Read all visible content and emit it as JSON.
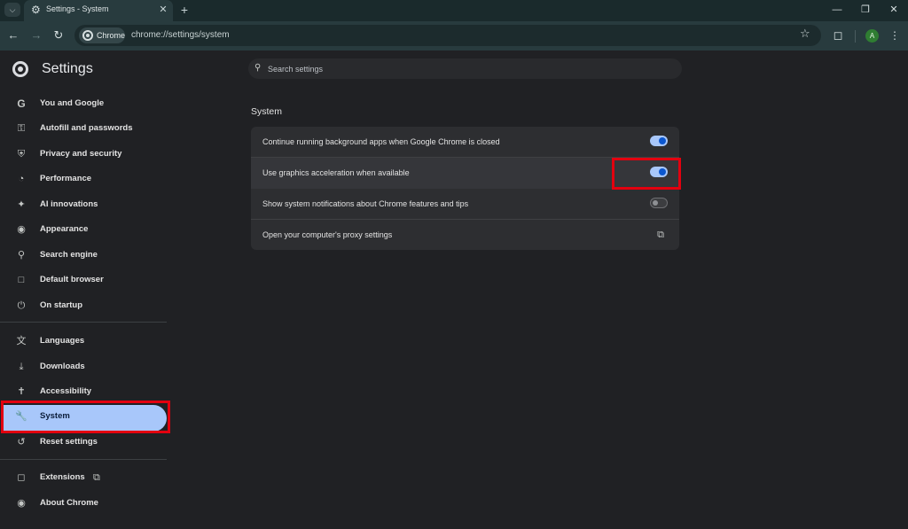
{
  "tabstrip": {
    "tab_title": "Settings - System",
    "icons": {
      "tab_search": "chevron-down-icon",
      "tab_favicon": "gear-icon",
      "close": "close-icon",
      "new_tab": "plus-icon",
      "minimize": "minimize-icon",
      "restore": "restore-icon",
      "window_close": "close-icon"
    }
  },
  "toolbar": {
    "chip_label": "Chrome",
    "url": "chrome://settings/system",
    "avatar_initial": "A",
    "icons": {
      "back": "arrow-left-icon",
      "forward": "arrow-right-icon",
      "reload": "reload-icon",
      "bookmark": "star-icon",
      "extensions": "puzzle-icon",
      "menu": "more-vert-icon"
    }
  },
  "sidebar": {
    "title": "Settings",
    "items": [
      {
        "label": "You and Google",
        "icon": "google-icon"
      },
      {
        "label": "Autofill and passwords",
        "icon": "key-icon"
      },
      {
        "label": "Privacy and security",
        "icon": "shield-icon"
      },
      {
        "label": "Performance",
        "icon": "speedometer-icon"
      },
      {
        "label": "AI innovations",
        "icon": "sparkle-icon"
      },
      {
        "label": "Appearance",
        "icon": "palette-icon"
      },
      {
        "label": "Search engine",
        "icon": "search-icon"
      },
      {
        "label": "Default browser",
        "icon": "browser-window-icon"
      },
      {
        "label": "On startup",
        "icon": "power-icon"
      },
      {
        "label": "Languages",
        "icon": "translate-icon"
      },
      {
        "label": "Downloads",
        "icon": "download-icon"
      },
      {
        "label": "Accessibility",
        "icon": "accessibility-icon"
      },
      {
        "label": "System",
        "icon": "wrench-icon",
        "active": true
      },
      {
        "label": "Reset settings",
        "icon": "reset-icon"
      },
      {
        "label": "Extensions",
        "icon": "puzzle-icon"
      },
      {
        "label": "About Chrome",
        "icon": "chrome-icon"
      }
    ]
  },
  "main": {
    "search_placeholder": "Search settings",
    "section_title": "System",
    "rows": [
      {
        "label": "Continue running background apps when Google Chrome is closed",
        "control": "toggle",
        "on": true
      },
      {
        "label": "Use graphics acceleration when available",
        "control": "toggle",
        "on": true
      },
      {
        "label": "Show system notifications about Chrome features and tips",
        "control": "toggle",
        "on": false
      },
      {
        "label": "Open your computer's proxy settings",
        "control": "open-in-new",
        "icon": "open-in-new-icon"
      }
    ]
  },
  "colors": {
    "page_bg": "#202124",
    "frame_bg": "#283b3e",
    "active_pill": "#a8c7fa",
    "toggle_on_knob": "#0b57d0",
    "highlight_box": "#e3000f"
  }
}
